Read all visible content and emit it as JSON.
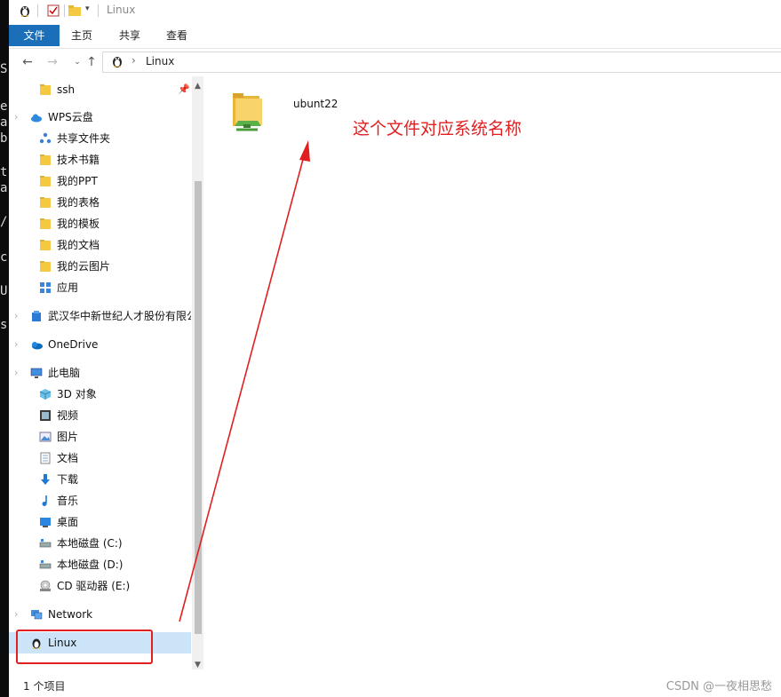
{
  "window": {
    "title": "Linux"
  },
  "terminal_glyphs": [
    "S",
    "e",
    "a",
    "b",
    "t",
    "a",
    "/",
    "c",
    "U",
    "s"
  ],
  "ribbon": {
    "tabs": [
      "文件",
      "主页",
      "共享",
      "查看"
    ]
  },
  "address": {
    "crumb": "Linux"
  },
  "sidebar": {
    "items": [
      {
        "label": "ssh",
        "icon": "folder-icon",
        "pinned": true
      },
      {
        "label": "WPS云盘",
        "icon": "cloud-icon"
      },
      {
        "label": "共享文件夹",
        "icon": "share-icon"
      },
      {
        "label": "技术书籍",
        "icon": "folder-icon"
      },
      {
        "label": "我的PPT",
        "icon": "folder-icon"
      },
      {
        "label": "我的表格",
        "icon": "folder-icon"
      },
      {
        "label": "我的模板",
        "icon": "folder-icon"
      },
      {
        "label": "我的文档",
        "icon": "folder-icon"
      },
      {
        "label": "我的云图片",
        "icon": "folder-icon"
      },
      {
        "label": "应用",
        "icon": "apps-icon"
      },
      {
        "label": "武汉华中新世纪人才股份有限公司",
        "icon": "building-icon"
      },
      {
        "label": "OneDrive",
        "icon": "onedrive-icon"
      },
      {
        "label": "此电脑",
        "icon": "computer-icon"
      },
      {
        "label": "3D 对象",
        "icon": "cube-icon"
      },
      {
        "label": "视频",
        "icon": "video-icon"
      },
      {
        "label": "图片",
        "icon": "picture-icon"
      },
      {
        "label": "文档",
        "icon": "document-icon"
      },
      {
        "label": "下载",
        "icon": "download-icon"
      },
      {
        "label": "音乐",
        "icon": "music-icon"
      },
      {
        "label": "桌面",
        "icon": "desktop-icon"
      },
      {
        "label": "本地磁盘 (C:)",
        "icon": "drive-icon"
      },
      {
        "label": "本地磁盘 (D:)",
        "icon": "drive-icon"
      },
      {
        "label": "CD 驱动器 (E:)",
        "icon": "cd-icon"
      },
      {
        "label": "Network",
        "icon": "network-icon"
      },
      {
        "label": "Linux",
        "icon": "linux-icon",
        "selected": true
      }
    ]
  },
  "content": {
    "files": [
      {
        "name": "ubunt22",
        "icon": "network-folder-icon"
      }
    ],
    "annotation": "这个文件对应系统名称"
  },
  "status": {
    "count": "1 个项目"
  },
  "watermark": "CSDN @一夜相思愁",
  "colors": {
    "file_tab": "#1a6fb8",
    "annotation": "#e02020",
    "selected": "#cce4f7",
    "folder": "#f5c842"
  }
}
